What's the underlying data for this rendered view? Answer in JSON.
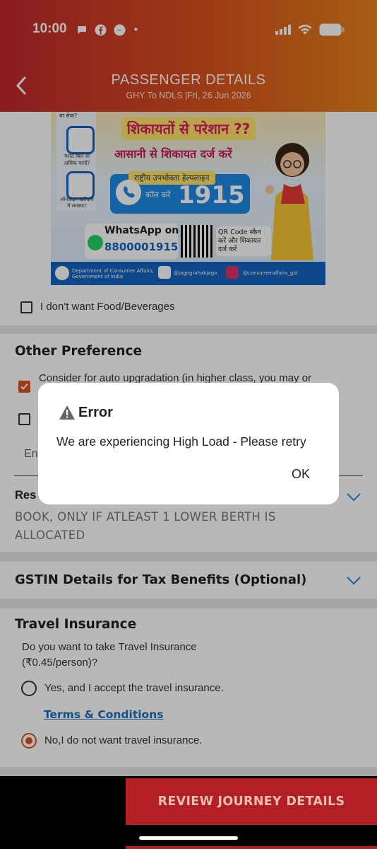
{
  "status_bar": {
    "time": "10:00",
    "dot": "•"
  },
  "header": {
    "title": "PASSENGER DETAILS",
    "subtitle": "GHY To NDLS |Fri, 26 Jun 2026"
  },
  "banner": {
    "headline": "शिकायतों से परेशान ??",
    "subheadline": "आसानी से शिकायत दर्ज करें",
    "hotline_label": "राष्ट्रीय उपभोक्ता हेल्पलाइन",
    "call_text": "कॉल करें",
    "hotline_number": "1915",
    "whatsapp_label": "WhatsApp on",
    "whatsapp_number": "8800001915",
    "qr_text": "QR Code स्कैन करें और शिकायत दर्ज करें",
    "footer_dept": "Department of Consumer Affairs, Government of India",
    "footer_x": "@jagograhakjago",
    "footer_insta": "@consumeraffairs_goi",
    "left_panel_top": "या सेवा?",
    "left_panel_mid": "गलत बिल या अधिक चार्ज?",
    "left_panel_bottom": "ऑनलाइन खरीदारी में समस्या?"
  },
  "food": {
    "label": "I don't want Food/Beverages",
    "checked": false
  },
  "other_preference": {
    "heading": "Other Preference",
    "auto_upgrade_label": "Consider for auto upgradation (in higher class, you may or",
    "auto_upgrade_checked": true,
    "second_checked": false,
    "email_placeholder_partial": "En"
  },
  "reservation_choice": {
    "label_partial": "Res",
    "value": "BOOK, ONLY IF ATLEAST 1 LOWER BERTH IS ALLOCATED"
  },
  "gstin": {
    "label": "GSTIN Details for Tax Benefits (Optional)"
  },
  "insurance": {
    "heading": "Travel Insurance",
    "question": "Do you want to take Travel Insurance (₹0.45/person)?",
    "yes_label": "Yes, and I accept the travel insurance.",
    "terms_link": "Terms & Conditions",
    "no_label": "No,I do not want travel insurance.",
    "selected": "no"
  },
  "review_button": "REVIEW JOURNEY DETAILS",
  "dialog": {
    "title": "Error",
    "message": "We are experiencing High Load - Please retry",
    "ok_label": "OK"
  },
  "colors": {
    "accent": "#d9531e",
    "header_start": "#c1272d",
    "header_end": "#e6821a",
    "review_bg": "#b21f24"
  }
}
